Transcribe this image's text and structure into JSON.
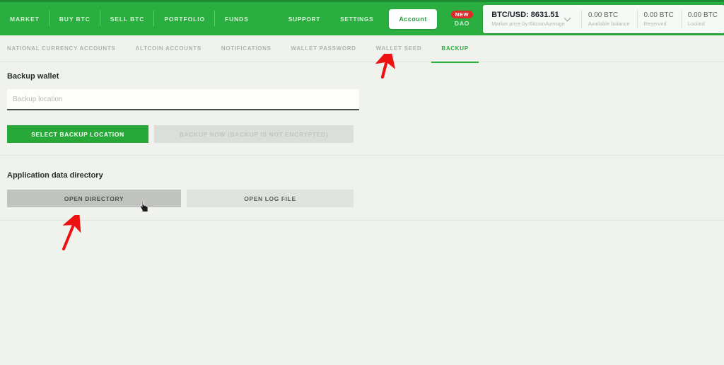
{
  "header": {
    "main_nav": [
      {
        "label": "MARKET",
        "name": "market"
      },
      {
        "label": "BUY BTC",
        "name": "buy-btc"
      },
      {
        "label": "SELL BTC",
        "name": "sell-btc"
      },
      {
        "label": "PORTFOLIO",
        "name": "portfolio"
      },
      {
        "label": "FUNDS",
        "name": "funds"
      }
    ],
    "secondary_nav": [
      {
        "label": "Support",
        "name": "support"
      },
      {
        "label": "Settings",
        "name": "settings"
      }
    ],
    "account_label": "Account",
    "dao": {
      "badge": "NEW",
      "label": "DAO"
    },
    "ticker": {
      "price": "BTC/USD: 8631.51",
      "price_source": "Market price by BitcoinAverage",
      "dropdown_icon": "chevron-down-icon",
      "cells": [
        {
          "value": "0.00 BTC",
          "caption": "Available balance"
        },
        {
          "value": "0.00 BTC",
          "caption": "Reserved"
        },
        {
          "value": "0.00 BTC",
          "caption": "Locked"
        }
      ]
    }
  },
  "subnav": {
    "tabs": [
      {
        "label": "NATIONAL CURRENCY ACCOUNTS",
        "name": "national-currency-accounts",
        "active": false
      },
      {
        "label": "ALTCOIN ACCOUNTS",
        "name": "altcoin-accounts",
        "active": false
      },
      {
        "label": "NOTIFICATIONS",
        "name": "notifications",
        "active": false
      },
      {
        "label": "WALLET PASSWORD",
        "name": "wallet-password",
        "active": false
      },
      {
        "label": "WALLET SEED",
        "name": "wallet-seed",
        "active": false
      },
      {
        "label": "BACKUP",
        "name": "backup",
        "active": true
      }
    ]
  },
  "backup_section": {
    "title": "Backup wallet",
    "location_value": "",
    "location_placeholder": "Backup location",
    "select_location_label": "SELECT BACKUP LOCATION",
    "backup_now_label": "BACKUP NOW (BACKUP IS NOT ENCRYPTED)"
  },
  "appdata_section": {
    "title": "Application data directory",
    "open_directory_label": "OPEN DIRECTORY",
    "open_log_file_label": "OPEN LOG FILE"
  },
  "annotations": {
    "arrow_color": "#ee1111",
    "arrow_backup_name": "arrow-pointing-to-backup-tab",
    "arrow_opendir_name": "arrow-pointing-to-open-directory-button",
    "cursor_name": "hand-cursor"
  },
  "colors": {
    "brand_green": "#2aae3f",
    "brand_green_dark": "#1f8c31",
    "button_green": "#27a838",
    "badge_red": "#e02b2b",
    "page_bg": "#f0f2ee"
  }
}
